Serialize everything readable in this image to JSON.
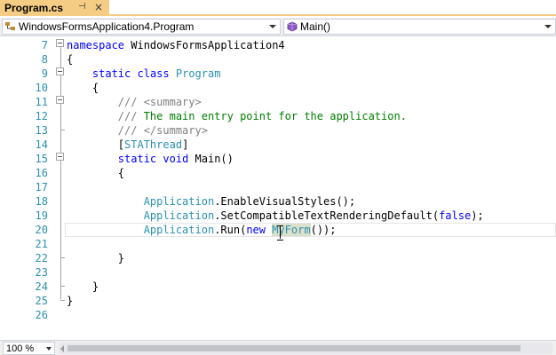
{
  "tab": {
    "title": "Program.cs",
    "pin_glyph": "⊣",
    "close_glyph": "×"
  },
  "navbar": {
    "left_combo": {
      "icon": "class-icon",
      "text": "WindowsFormsApplication4.Program"
    },
    "right_combo": {
      "icon": "method-icon",
      "text": "Main()"
    }
  },
  "editor": {
    "current_line": 20,
    "lines": [
      {
        "num": "7",
        "segments": [
          {
            "t": "kw",
            "v": "namespace"
          },
          {
            "t": "",
            "v": " WindowsFormsApplication4"
          }
        ]
      },
      {
        "num": "8",
        "segments": [
          {
            "t": "",
            "v": "{"
          }
        ]
      },
      {
        "num": "9",
        "segments": [
          {
            "t": "",
            "v": "    "
          },
          {
            "t": "kw",
            "v": "static"
          },
          {
            "t": "",
            "v": " "
          },
          {
            "t": "kw",
            "v": "class"
          },
          {
            "t": "",
            "v": " "
          },
          {
            "t": "type",
            "v": "Program"
          }
        ]
      },
      {
        "num": "10",
        "segments": [
          {
            "t": "",
            "v": "    {"
          }
        ]
      },
      {
        "num": "11",
        "segments": [
          {
            "t": "",
            "v": "        "
          },
          {
            "t": "doc",
            "v": "/// <summary>"
          }
        ]
      },
      {
        "num": "12",
        "segments": [
          {
            "t": "",
            "v": "        "
          },
          {
            "t": "doc",
            "v": "///"
          },
          {
            "t": "cm",
            "v": " The main entry point for the application."
          }
        ]
      },
      {
        "num": "13",
        "segments": [
          {
            "t": "",
            "v": "        "
          },
          {
            "t": "doc",
            "v": "/// </summary>"
          }
        ]
      },
      {
        "num": "14",
        "segments": [
          {
            "t": "",
            "v": "        ["
          },
          {
            "t": "type",
            "v": "STAThread"
          },
          {
            "t": "",
            "v": "]"
          }
        ]
      },
      {
        "num": "15",
        "segments": [
          {
            "t": "",
            "v": "        "
          },
          {
            "t": "kw",
            "v": "static"
          },
          {
            "t": "",
            "v": " "
          },
          {
            "t": "kw",
            "v": "void"
          },
          {
            "t": "",
            "v": " Main()"
          }
        ]
      },
      {
        "num": "16",
        "segments": [
          {
            "t": "",
            "v": "        {"
          }
        ]
      },
      {
        "num": "17",
        "segments": [
          {
            "t": "",
            "v": ""
          }
        ]
      },
      {
        "num": "18",
        "segments": [
          {
            "t": "",
            "v": "            "
          },
          {
            "t": "type",
            "v": "Application"
          },
          {
            "t": "",
            "v": ".EnableVisualStyles();"
          }
        ]
      },
      {
        "num": "19",
        "segments": [
          {
            "t": "",
            "v": "            "
          },
          {
            "t": "type",
            "v": "Application"
          },
          {
            "t": "",
            "v": ".SetCompatibleTextRenderingDefault("
          },
          {
            "t": "kw",
            "v": "false"
          },
          {
            "t": "",
            "v": ");"
          }
        ]
      },
      {
        "num": "20",
        "segments": [
          {
            "t": "",
            "v": "            "
          },
          {
            "t": "type",
            "v": "Application"
          },
          {
            "t": "",
            "v": ".Run("
          },
          {
            "t": "kw",
            "v": "new"
          },
          {
            "t": "",
            "v": " "
          },
          {
            "t": "type hl",
            "v": "MyForm"
          },
          {
            "t": "",
            "v": "());"
          }
        ]
      },
      {
        "num": "21",
        "segments": [
          {
            "t": "",
            "v": ""
          }
        ]
      },
      {
        "num": "22",
        "segments": [
          {
            "t": "",
            "v": "        }"
          }
        ]
      },
      {
        "num": "23",
        "segments": [
          {
            "t": "",
            "v": ""
          }
        ]
      },
      {
        "num": "24",
        "segments": [
          {
            "t": "",
            "v": "    }"
          }
        ]
      },
      {
        "num": "25",
        "segments": [
          {
            "t": "",
            "v": "}"
          }
        ]
      },
      {
        "num": "26",
        "segments": [
          {
            "t": "",
            "v": ""
          }
        ]
      }
    ]
  },
  "bottombar": {
    "zoom": "100 %"
  },
  "colors": {
    "tab_accent": "#f5cc84",
    "keyword": "#0000ff",
    "type": "#2b91af",
    "comment": "#008000",
    "doc_comment": "#808080",
    "line_number": "#2b91af"
  }
}
